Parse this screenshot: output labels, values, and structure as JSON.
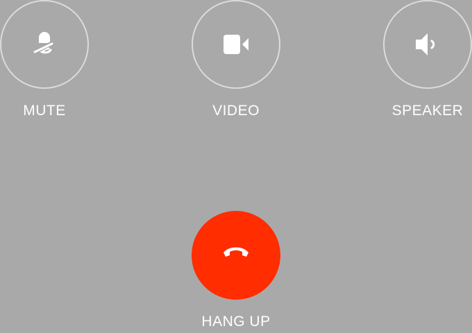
{
  "controls": {
    "mute": {
      "label": "MUTE",
      "icon": "mic-off-icon"
    },
    "video": {
      "label": "VIDEO",
      "icon": "video-camera-icon"
    },
    "speaker": {
      "label": "SPEAKER",
      "icon": "speaker-icon"
    },
    "hangup": {
      "label": "HANG UP",
      "icon": "phone-hangup-icon"
    }
  },
  "colors": {
    "background": "#a9a9a9",
    "hangup": "#ff2d00",
    "ring": "#dcdcdc",
    "text": "#ffffff"
  }
}
